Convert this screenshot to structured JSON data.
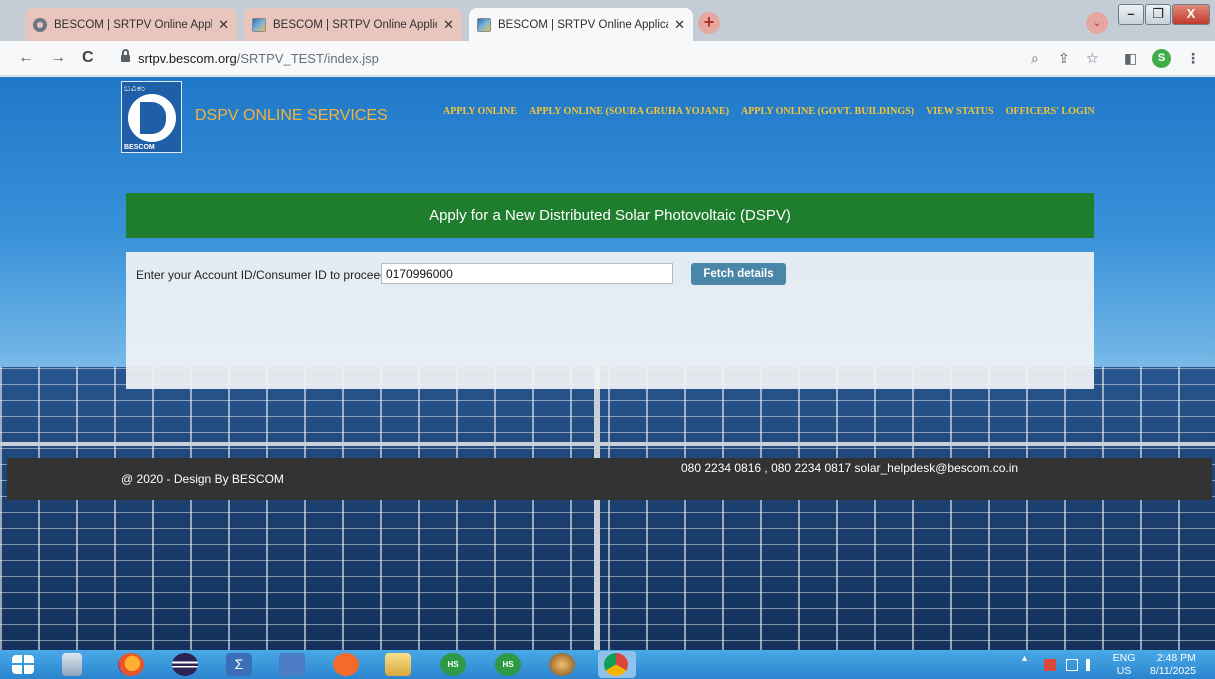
{
  "browser": {
    "tabs": [
      {
        "title": "BESCOM | SRTPV Online Applicat",
        "favicon": "globe-icon",
        "active": false
      },
      {
        "title": "BESCOM | SRTPV Online Applicat",
        "favicon": "solar-panel-icon",
        "active": false
      },
      {
        "title": "BESCOM | SRTPV Online Applicat",
        "favicon": "solar-panel-icon",
        "active": true
      }
    ],
    "close_glyph": "✕",
    "new_tab_glyph": "+",
    "tab_search_glyph": "⌄",
    "window": {
      "minimize": "–",
      "restore": "❐",
      "close": "X"
    },
    "address": {
      "host": "srtpv.bescom.org",
      "path": "/SRTPV_TEST/index.jsp"
    },
    "nav": {
      "back": "←",
      "forward": "→",
      "reload": "C"
    },
    "toolbar_icons": {
      "zoom": "⌕",
      "share": "⇪",
      "bookmark": "☆",
      "sidepanel": "◧",
      "menu": "⋮"
    },
    "profile_initial": "S"
  },
  "site": {
    "logo": {
      "kannada": "ಬವಿಕಂ",
      "brand": "BESCOM"
    },
    "title": "DSPV ONLINE SERVICES",
    "nav": [
      "APPLY ONLINE",
      "APPLY ONLINE (SOURA GRUHA YOJANE)",
      "APPLY ONLINE (GOVT. BUILDINGS)",
      "VIEW STATUS",
      "OFFICERS' LOGIN"
    ],
    "banner": "Apply for a New Distributed Solar Photovoltaic (DSPV)",
    "form": {
      "label": "Enter your Account ID/Consumer ID to proceed",
      "value": "0170996000",
      "button": "Fetch details"
    },
    "footer": {
      "copyright": "@ 2020 - Design By  BESCOM",
      "contact": "080 2234 0816 , 080 2234 0817    solar_helpdesk@bescom.co.in"
    }
  },
  "taskbar": {
    "apps": [
      "windows-start-icon",
      "file-server-icon",
      "firefox-icon",
      "eclipse-icon",
      "sigma-icon",
      "code-editor-icon",
      "pen-tool-icon",
      "file-explorer-icon",
      "hs-app-icon",
      "hs-app-icon",
      "game-icon",
      "chrome-icon"
    ],
    "hs_label": "HS",
    "lang": "ENG",
    "region": "US",
    "time": "2:48 PM",
    "date": "8/11/2025"
  }
}
